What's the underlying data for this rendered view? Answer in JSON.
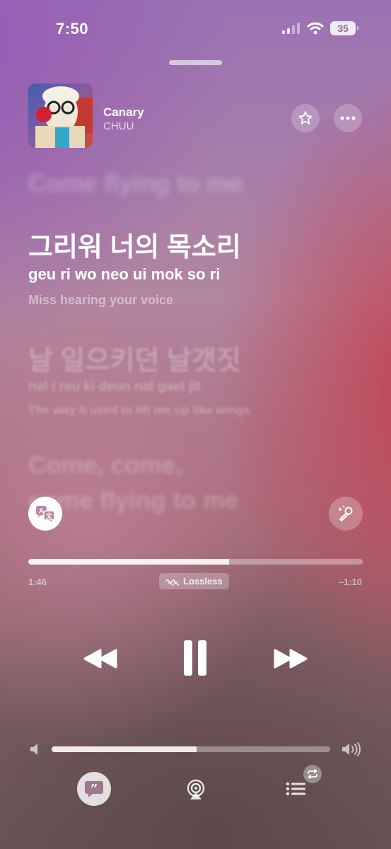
{
  "status": {
    "time": "7:50",
    "battery": "35"
  },
  "now_playing": {
    "title": "Canary",
    "artist": "CHUU",
    "quality_badge": "Lossless",
    "elapsed": "1:46",
    "remaining": "–1:10",
    "progress_fraction": 0.6,
    "volume_fraction": 0.52
  },
  "lyrics": {
    "previous": "Come flying to me",
    "current": {
      "korean": "그리워 너의 목소리",
      "romanization": "geu ri wo  neo ui  mok so ri",
      "translation": "Miss hearing your voice"
    },
    "next": {
      "korean": "날 일으키던 날갯짓",
      "romanization": "nal  i reu ki deon  nal gaet jit",
      "translation": "The way it used to lift me up like wings"
    },
    "after": [
      "Come, come,",
      "come flying to me"
    ]
  },
  "icons": {
    "star": "star-icon",
    "more": "more-icon",
    "translate": "translate-icon",
    "sing": "microphone-sparkles-icon",
    "rewind": "rewind-icon",
    "pause": "pause-icon",
    "forward": "fast-forward-icon",
    "volume_low": "speaker-low-icon",
    "volume_high": "speaker-high-icon",
    "lyrics": "lyrics-quote-icon",
    "airplay": "airplay-icon",
    "queue": "queue-list-icon",
    "repeat": "repeat-icon"
  }
}
